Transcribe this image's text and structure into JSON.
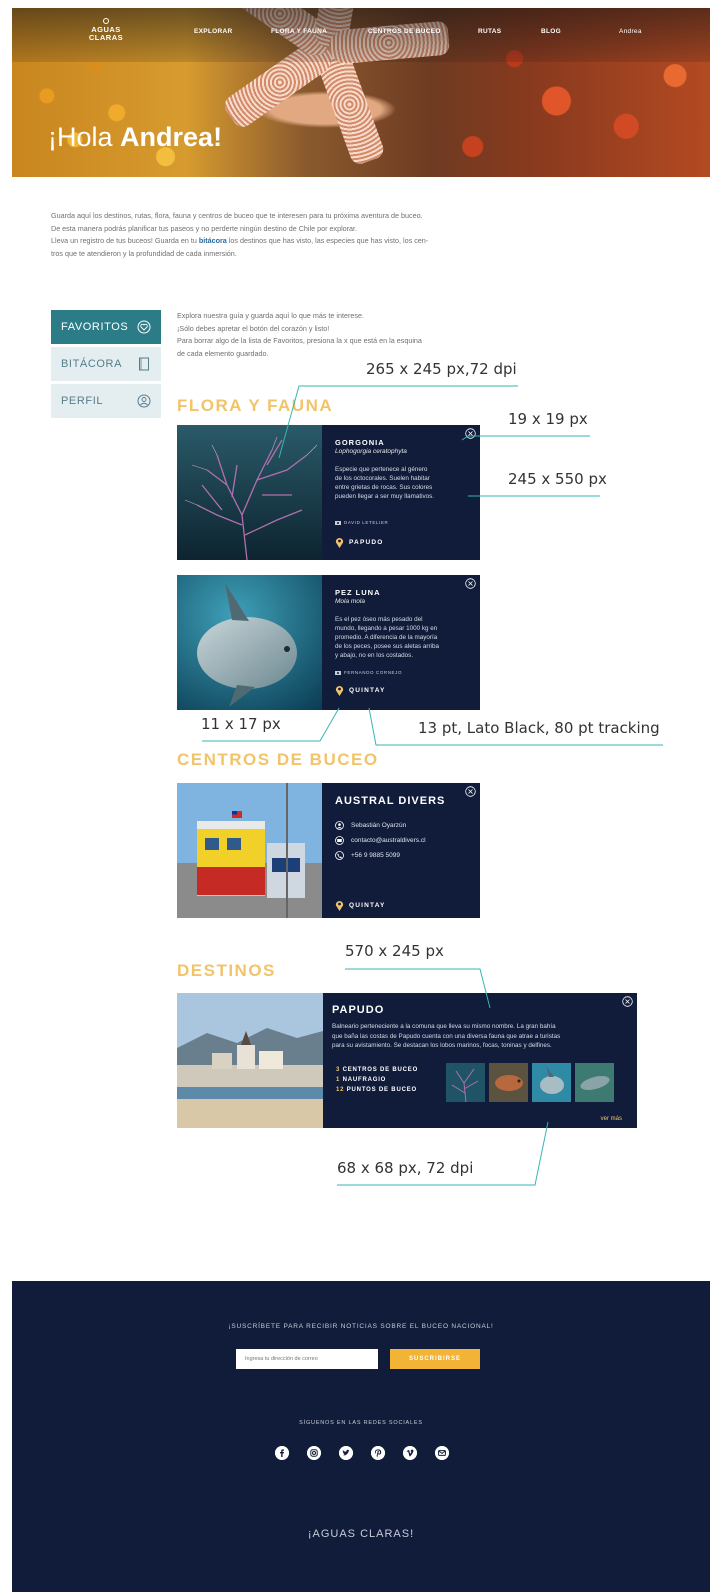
{
  "brand": {
    "logo_line1": "AGUAS",
    "logo_line2": "CLARAS"
  },
  "nav": {
    "items": [
      "EXPLORAR",
      "FLORA Y FAUNA",
      "CENTROS DE BUCEO",
      "RUTAS",
      "BLOG"
    ],
    "user": "Andrea"
  },
  "hero": {
    "greeting_prefix": "¡Hola",
    "greeting_name": "Andrea!"
  },
  "intro": {
    "line1": "Guarda aquí los destinos, rutas, flora, fauna y centros de buceo que te interesen para tu próxima aventura de buceo.",
    "line2": "De esta manera podrás planificar tus paseos y no perderte ningún destino de Chile por explorar.",
    "line3_pre": "Lleva un registro de tus buceos! Guarda en tu",
    "line3_link": "bitácora",
    "line3_post": "los destinos que has visto, las especies que has visto, los cen-",
    "line4": "tros que te atendieron y la profundidad de cada inmersión."
  },
  "sidebar": {
    "items": [
      {
        "label": "FAVORITOS",
        "icon": "heart-icon"
      },
      {
        "label": "BITÁCORA",
        "icon": "book-icon"
      },
      {
        "label": "PERFIL",
        "icon": "user-icon"
      }
    ]
  },
  "explain": {
    "line1": "Explora nuestra guía y guarda aquí lo que más te interese.",
    "line2": "¡Sólo debes apretar el botón del corazón y listo!",
    "line3": "Para borrar algo de la lista de Favoritos, presiona la x que está en la esquina",
    "line4": "de cada elemento guardado."
  },
  "sections": {
    "flora": "FLORA Y FAUNA",
    "centros": "CENTROS DE BUCEO",
    "destinos": "DESTINOS"
  },
  "cards": {
    "gorgonia": {
      "title": "GORGONIA",
      "scientific": "Lophogorgia ceratophyta",
      "desc": [
        "Especie que pertenece al género",
        "de los octocorales. Suelen habitar",
        "entre grietas de rocas. Sus colores",
        "pueden llegar a ser muy llamativos."
      ],
      "author": "DAVID LETELIER",
      "location": "PAPUDO"
    },
    "pezluna": {
      "title": "PEZ LUNA",
      "scientific": "Mola mola",
      "desc": [
        "Es el pez óseo más pesado del",
        "mundo, llegando a pesar 1000 kg en",
        "promedio. A diferencia de la mayoría",
        "de los peces, posee sus aletas arriba",
        "y abajo, no en los costados."
      ],
      "author": "FERNANDO CORNEJO",
      "location": "QUINTAY"
    },
    "austral": {
      "title": "AUSTRAL DIVERS",
      "contact_name": "Sebastián Oyarzún",
      "email": "contacto@australdivers.cl",
      "phone": "+56 9 9885 5099",
      "location": "QUINTAY"
    },
    "papudo": {
      "title": "PAPUDO",
      "desc": [
        "Balneario perteneciente a la comuna que lleva su mismo nombre. La gran bahía",
        "que baña las costas de Papudo cuenta con una diversa fauna que atrae a turistas",
        "para su avistamiento. Se destacan los lobos marinos, focas, toninas y delfines."
      ],
      "stats": [
        {
          "n": "3",
          "label": "CENTROS DE BUCEO"
        },
        {
          "n": "1",
          "label": "NAUFRAGIO"
        },
        {
          "n": "12",
          "label": "PUNTOS DE BUCEO"
        }
      ],
      "more": "ver más"
    }
  },
  "annotations": {
    "a1": "265 x 245 px,72 dpi",
    "a2": "19 x 19 px",
    "a3": "245 x 550 px",
    "a4": "11 x 17 px",
    "a5": "13 pt, Lato Black, 80 pt tracking",
    "a6": "570 x 245 px",
    "a7": "68 x 68 px, 72 dpi"
  },
  "footer": {
    "subscribe_text": "¡SUSCRÍBETE PARA RECIBIR NOTICIAS SOBRE EL BUCEO NACIONAL!",
    "email_placeholder": "Ingresa tu dirección de correo",
    "subscribe_button": "SUSCRIBIRSE",
    "social_text": "SÍGUENOS EN LAS REDES SOCIALES",
    "social_icons": [
      "facebook-icon",
      "instagram-icon",
      "twitter-icon",
      "pinterest-icon",
      "vimeo-icon",
      "mail-icon"
    ],
    "brand": "¡AGUAS CLARAS!"
  },
  "colors": {
    "navy": "#101c3a",
    "teal": "#2c7c88",
    "gold": "#f2c46a",
    "annotation_line": "#37b5b0"
  }
}
